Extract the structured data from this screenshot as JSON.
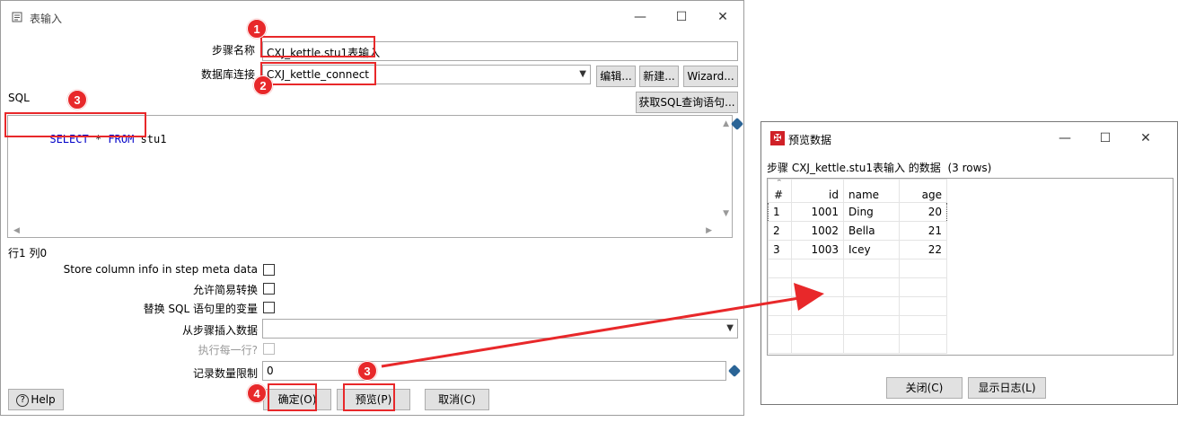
{
  "main_window": {
    "title": "表输入",
    "step_name_label": "步骤名称",
    "step_name_value": "CXJ_kettle.stu1表输入",
    "db_conn_label": "数据库连接",
    "db_conn_value": "CXJ_kettle_connect",
    "edit_btn": "编辑...",
    "new_btn": "新建...",
    "wizard_btn": "Wizard...",
    "sql_label": "SQL",
    "get_sql_btn": "获取SQL查询语句...",
    "sql_kw1": "SELECT",
    "sql_mid": " * ",
    "sql_kw2": "FROM",
    "sql_rest": " stu1",
    "cursor_pos": "行1 列0",
    "store_col_label": "Store column info in step meta data",
    "allow_lazy_label": "允许简易转换",
    "replace_vars_label": "替换 SQL 语句里的变量",
    "insert_from_label": "从步骤插入数据",
    "exec_each_label": "执行每一行?",
    "limit_label": "记录数量限制",
    "limit_value": "0",
    "help_btn": "Help",
    "ok_btn": "确定(O)",
    "preview_btn": "预览(P)",
    "cancel_btn": "取消(C)"
  },
  "preview_window": {
    "title": "预览数据",
    "subtitle": "步骤 CXJ_kettle.stu1表输入 的数据  (3 rows)",
    "columns": [
      "#",
      "id",
      "name",
      "age"
    ],
    "rows": [
      [
        "1",
        "1001",
        "Ding",
        "20"
      ],
      [
        "2",
        "1002",
        "Bella",
        "21"
      ],
      [
        "3",
        "1003",
        "Icey",
        "22"
      ]
    ],
    "close_btn": "关闭(C)",
    "show_log_btn": "显示日志(L)"
  },
  "annotations": {
    "b1": "1",
    "b2": "2",
    "b3a": "3",
    "b3b": "3",
    "b4": "4"
  },
  "colors": {
    "annotation_red": "#e8282a",
    "sql_keyword": "#0000c8"
  }
}
